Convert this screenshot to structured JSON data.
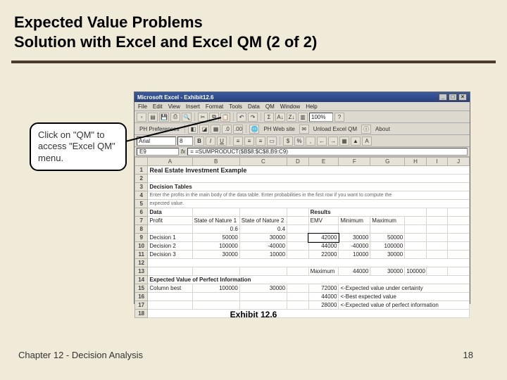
{
  "slide": {
    "title_line1": "Expected Value Problems",
    "title_line2": "Solution with Excel and Excel QM (2 of 2)",
    "exhibit_caption": "Exhibit 12.6",
    "footer_left": "Chapter 12 - Decision Analysis",
    "footer_right": "18"
  },
  "callout": {
    "text_l1": "Click on \"QM\" to",
    "text_l2": "access \"Excel QM\"",
    "text_l3": "menu."
  },
  "excel": {
    "titlebar": "Microsoft Excel - Exhibit12.6",
    "menu": [
      "File",
      "Edit",
      "View",
      "Insert",
      "Format",
      "Tools",
      "Data",
      "QM",
      "Window",
      "Help"
    ],
    "toolbar_right": {
      "web_label": "PH Web site",
      "unload_label": "Unload Excel QM",
      "about_label": "About",
      "zoom": "100%"
    },
    "format_bar": {
      "font": "Arial",
      "size": "8"
    },
    "namebox": "E9",
    "formula": "= =SUMPRODUCT($B$8:$C$8,B9:C9)",
    "col_headers": [
      "A",
      "B",
      "C",
      "D",
      "E",
      "F",
      "G",
      "H",
      "I",
      "J"
    ],
    "rows": {
      "1": {
        "A": "Real Estate Investment Example"
      },
      "2": {},
      "3": {
        "A": "Decision Tables"
      },
      "4": {
        "A": "Enter the profits in the main body of the data table. Enter probabilities in the first row if you want to compute the"
      },
      "5": {
        "A": "expected value."
      },
      "6": {
        "A": "Data",
        "E": "Results"
      },
      "7": {
        "A": "Profit",
        "B": "State of Nature 1",
        "C": "State of Nature 2",
        "E": "EMV",
        "F": "Minimum",
        "G": "Maximum"
      },
      "8": {
        "B": "0.6",
        "C": "0.4"
      },
      "9": {
        "A": "Decision 1",
        "B": "50000",
        "C": "30000",
        "E": "42000",
        "F": "30000",
        "G": "50000"
      },
      "10": {
        "A": "Decision 2",
        "B": "100000",
        "C": "-40000",
        "E": "44000",
        "F": "-40000",
        "G": "100000"
      },
      "11": {
        "A": "Decision 3",
        "B": "30000",
        "C": "10000",
        "E": "22000",
        "F": "10000",
        "G": "30000"
      },
      "12": {},
      "13": {
        "E": "Maximum",
        "F": "44000",
        "G": "30000",
        "H": "100000"
      },
      "14": {
        "A": "Expected Value of Perfect Information"
      },
      "15": {
        "A": "Column best",
        "B": "100000",
        "C": "30000",
        "E": "72000",
        "F": "<-Expected value under certainty"
      },
      "16": {
        "E": "44000",
        "F": "<-Best expected value"
      },
      "17": {
        "E": "28000",
        "F": "<-Expected value of perfect information"
      },
      "18": {}
    }
  }
}
